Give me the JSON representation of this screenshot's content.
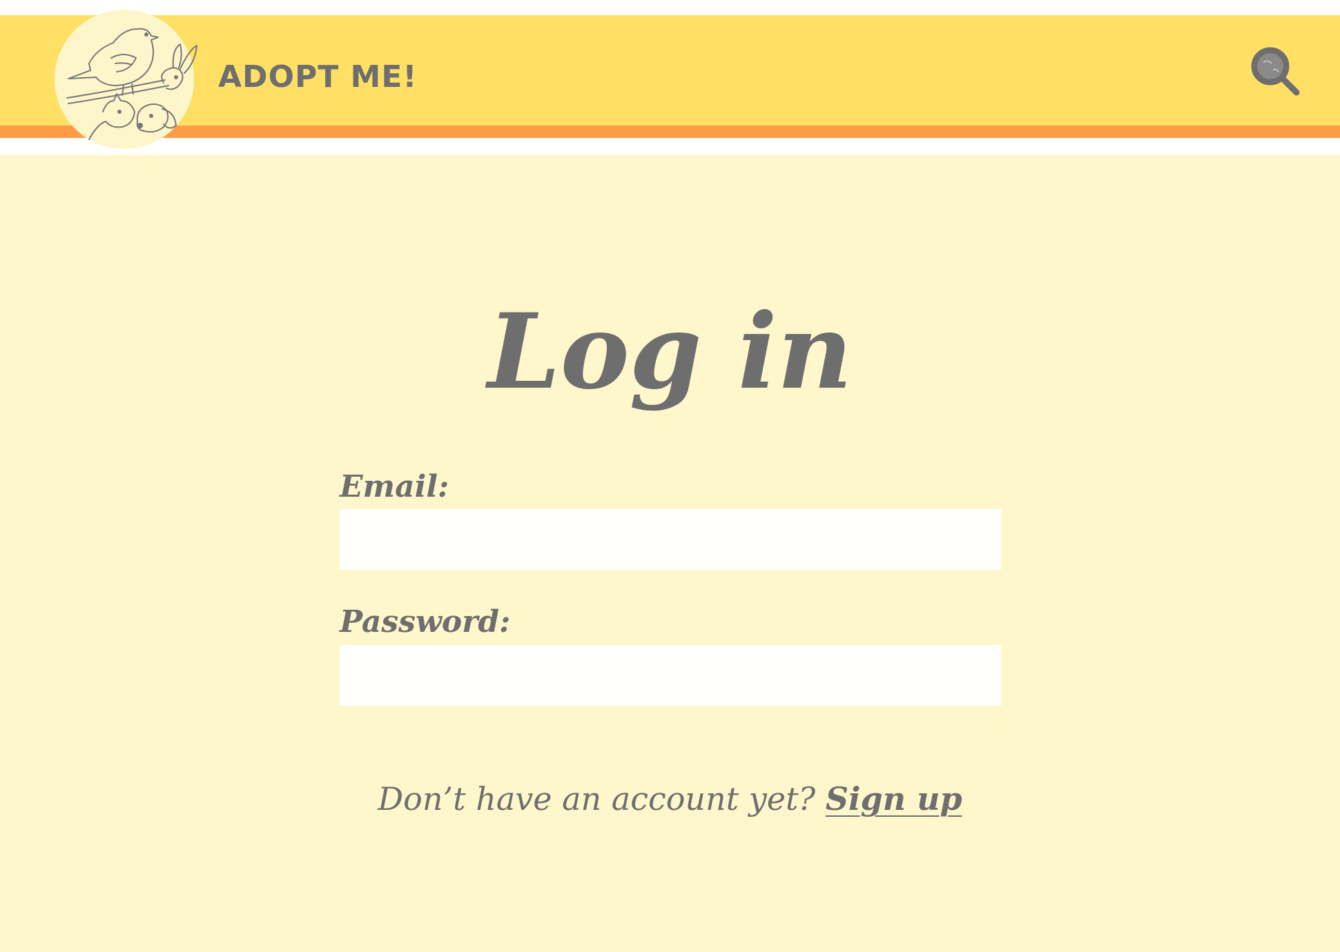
{
  "header": {
    "title": "ADOPT ME!",
    "logo_icon": "pets-logo-icon",
    "search_icon": "search-icon"
  },
  "main": {
    "page_title": "Log in",
    "email_label": "Email:",
    "email_value": "",
    "password_label": "Password:",
    "password_value": "",
    "signup_prompt": "Don’t have an account yet?",
    "signup_link": "Sign up"
  },
  "colors": {
    "header_background": "#ffe065",
    "header_stripe": "#ff9c45",
    "page_background": "#fff7cc",
    "input_background": "#fffffd",
    "text": "#6e6e6e"
  }
}
